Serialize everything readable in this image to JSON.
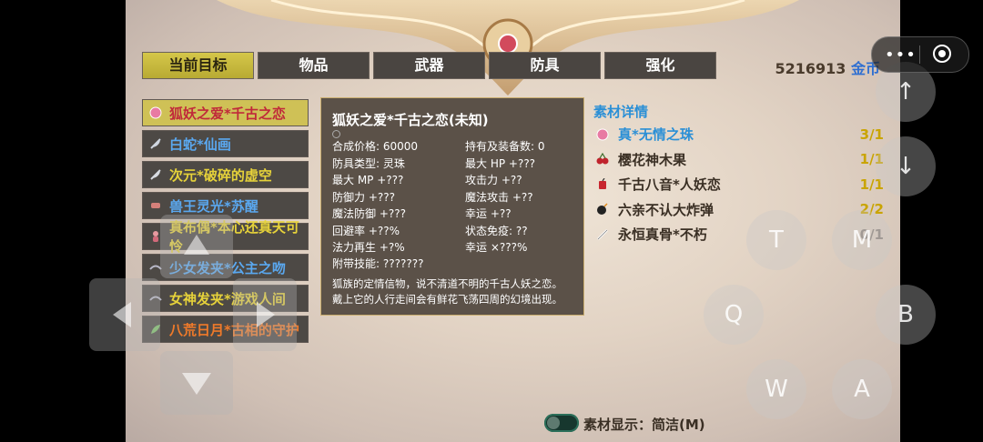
{
  "tabs": [
    {
      "label": "当前目标",
      "active": true
    },
    {
      "label": "物品"
    },
    {
      "label": "武器"
    },
    {
      "label": "防具"
    },
    {
      "label": "强化"
    }
  ],
  "gold": {
    "amount": "5216913",
    "unit": "金币"
  },
  "items": [
    {
      "name": "狐妖之爱*千古之恋",
      "color": "#c0293a",
      "icon": "pink-orb-icon"
    },
    {
      "name": "白蛇*仙画",
      "color": "#5aa8f0",
      "icon": "feather-icon"
    },
    {
      "name": "次元*破碎的虚空",
      "color": "#e6d23a",
      "icon": "feather-icon"
    },
    {
      "name": "兽王灵光*苏醒",
      "color": "#5aa8f0",
      "icon": "scroll-icon"
    },
    {
      "name": "真布偶*本心还真天可怜",
      "color": "#e6d23a",
      "icon": "doll-icon"
    },
    {
      "name": "少女发夹*公主之吻",
      "color": "#5aa8f0",
      "icon": "hairclip-icon"
    },
    {
      "name": "女神发夹*游戏人间",
      "color": "#e6d23a",
      "icon": "hairclip-icon"
    },
    {
      "name": "八荒日月*古相的守护",
      "color": "#f07a2a",
      "icon": "leaf-icon"
    }
  ],
  "detail": {
    "title": "狐妖之爱*千古之恋(未知)",
    "stats": [
      "合成价格: 60000",
      "持有及装备数: 0",
      "防具类型: 灵珠",
      "最大 HP +???",
      "最大 MP +???",
      "攻击力 +??",
      "防御力 +???",
      "魔法攻击 +??",
      "魔法防御 +???",
      "幸运 +??",
      "回避率 +??%",
      "状态免疫: ??",
      "法力再生 +?%",
      "幸运 ×???%"
    ],
    "skill": "附带技能: ???????",
    "desc_line1": "狐族的定情信物，说不清道不明的千古人妖之恋。",
    "desc_line2": "戴上它的人行走间会有鲜花飞荡四周的幻境出现。"
  },
  "materials_header": "素材详情",
  "materials": [
    {
      "name": "真*无情之珠",
      "qty": "3/1",
      "icon": "pink-orb-icon",
      "highlight": true
    },
    {
      "name": "樱花神木果",
      "qty": "1/1",
      "icon": "cherry-icon"
    },
    {
      "name": "千古八音*人妖恋",
      "qty": "1/1",
      "icon": "firecracker-icon"
    },
    {
      "name": "六亲不认大炸弹",
      "qty": "2/2",
      "icon": "bomb-icon"
    },
    {
      "name": "永恒真骨*不朽",
      "qty": "0/1",
      "icon": "bone-icon",
      "gray": true
    }
  ],
  "display_mode": {
    "label": "素材显示：简洁(M)"
  },
  "overlay_buttons": {
    "t": "T",
    "m": "M",
    "q": "Q",
    "b": "B",
    "w": "W",
    "a": "A",
    "up": "↑",
    "down": "↓"
  }
}
